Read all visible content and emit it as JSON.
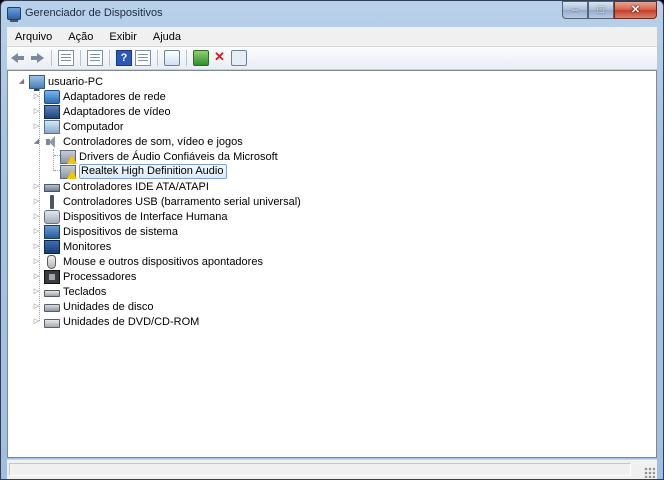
{
  "window": {
    "title": "Gerenciador de Dispositivos",
    "caption_buttons": {
      "minimize": "–",
      "maximize": "□",
      "close": "✕"
    }
  },
  "menu": [
    "Arquivo",
    "Ação",
    "Exibir",
    "Ajuda"
  ],
  "toolbar": {
    "buttons": [
      "back-icon",
      "forward-icon",
      "properties-icon",
      "show-hide-icon",
      "help-icon",
      "view-icon",
      "scan-hardware-icon",
      "update-driver-icon",
      "uninstall-icon",
      "enable-device-icon"
    ]
  },
  "tree": {
    "root": "usuario-PC",
    "categories": [
      {
        "label": "Adaptadores de rede",
        "icon": "network-adapter-icon",
        "expanded": false
      },
      {
        "label": "Adaptadores de vídeo",
        "icon": "display-adapter-icon",
        "expanded": false
      },
      {
        "label": "Computador",
        "icon": "computer-icon",
        "expanded": false
      },
      {
        "label": "Controladores de som, vídeo e jogos",
        "icon": "speaker-icon",
        "expanded": true,
        "children": [
          {
            "label": "Drivers de Áudio Confiáveis da Microsoft",
            "icon": "warning-device-icon",
            "selected": false
          },
          {
            "label": "Realtek High Definition Audio",
            "icon": "warning-device-icon",
            "selected": true
          }
        ]
      },
      {
        "label": "Controladores IDE ATA/ATAPI",
        "icon": "ide-controller-icon",
        "expanded": false
      },
      {
        "label": "Controladores USB (barramento serial universal)",
        "icon": "usb-icon",
        "expanded": false
      },
      {
        "label": "Dispositivos de Interface Humana",
        "icon": "hid-icon",
        "expanded": false
      },
      {
        "label": "Dispositivos de sistema",
        "icon": "system-device-icon",
        "expanded": false
      },
      {
        "label": "Monitores",
        "icon": "monitor-icon",
        "expanded": false
      },
      {
        "label": "Mouse e outros dispositivos apontadores",
        "icon": "mouse-icon",
        "expanded": false
      },
      {
        "label": "Processadores",
        "icon": "processor-icon",
        "expanded": false
      },
      {
        "label": "Teclados",
        "icon": "keyboard-icon",
        "expanded": false
      },
      {
        "label": "Unidades de disco",
        "icon": "disk-drive-icon",
        "expanded": false
      },
      {
        "label": "Unidades de DVD/CD-ROM",
        "icon": "dvd-drive-icon",
        "expanded": false
      }
    ]
  }
}
